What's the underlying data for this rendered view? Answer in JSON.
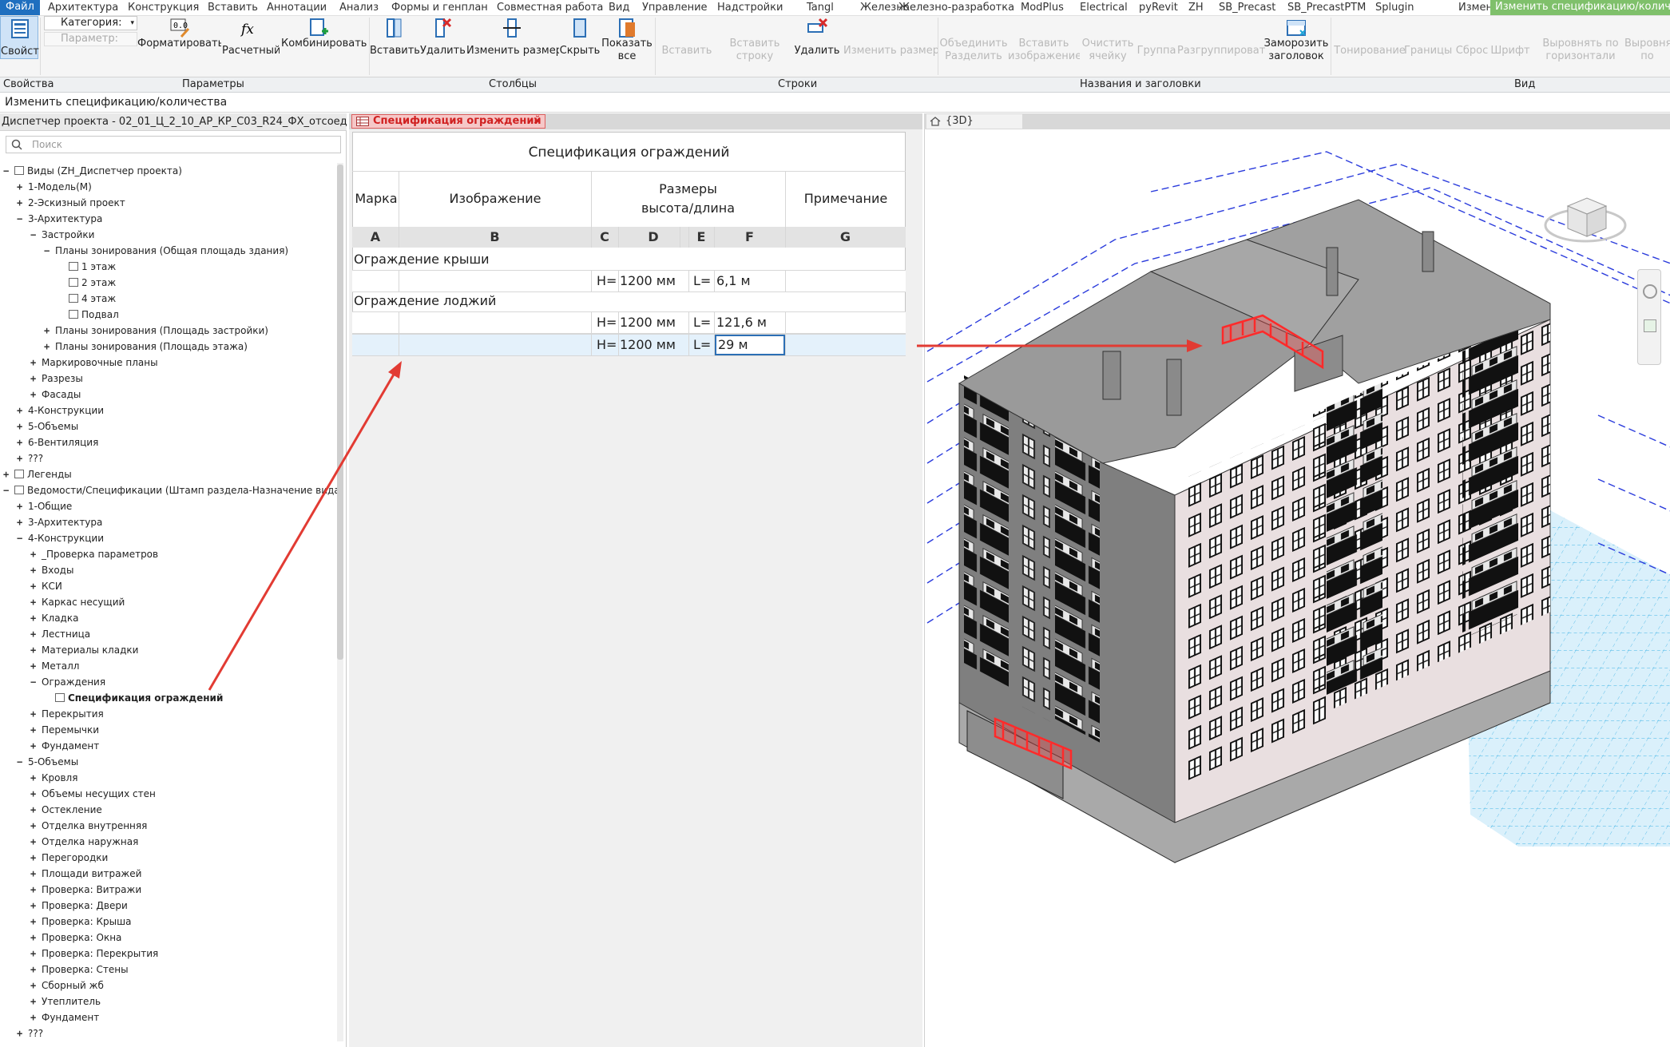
{
  "menu": {
    "items": [
      "Файл",
      "Архитектура",
      "Конструкция",
      "Вставить",
      "Аннотации",
      "Анализ",
      "Формы и генплан",
      "Совместная работа",
      "Вид",
      "Управление",
      "Надстройки",
      "Tangl",
      "Железно",
      "Железно-разработка",
      "ModPlus",
      "Electrical",
      "pyRevit",
      "ZH",
      "SB_Precast",
      "SB_PrecastPTM",
      "Splugin",
      "Изменить",
      "Изменить спецификацию/количес"
    ]
  },
  "ribbon": {
    "properties_btn": "Свойства",
    "category_label": "Категория:",
    "parameter_label": "Параметр:",
    "format_units": "Форматировать единицу",
    "calculated": "Расчетный",
    "combine_params": "Комбинировать параметры",
    "insert": "Вставить",
    "delete": "Удалить",
    "resize": "Изменить размер",
    "hide": "Скрыть",
    "show_all": "Показать все",
    "rows_insert": "Вставить",
    "insert_data_row": "Вставить строку данных",
    "rows_delete": "Удалить",
    "rows_resize": "Изменить размер",
    "merge_unmerge": "Объединить Разделить",
    "insert_image": "Вставить изображение",
    "clear_cell": "Очистить ячейку",
    "group": "Группа",
    "ungroup": "Разгруппировать",
    "freeze_header": "Заморозить заголовок",
    "shading": "Тонирование",
    "borders": "Границы",
    "reset": "Сброс",
    "font": "Шрифт",
    "align_h": "Выровнять по горизонтали",
    "align_v": "Выровнять по верти...",
    "groups": {
      "properties": "Свойства",
      "parameters": "Параметры",
      "columns": "Столбцы",
      "rows": "Строки",
      "titles": "Названия и заголовки",
      "view": "Вид"
    }
  },
  "context_label": "Изменить спецификацию/количества",
  "browser": {
    "title": "Диспетчер проекта - 02_01_Ц_2_10_АР_КР_С03_R24_ФХ_отсоед...",
    "search_placeholder": "Поиск",
    "items": [
      {
        "t": "Виды (ZH_Диспетчер проекта)",
        "l": 0,
        "g": "−",
        "ic": true
      },
      {
        "t": "1-Модель(М)",
        "l": 1,
        "g": "+"
      },
      {
        "t": "2-Эскизный проект",
        "l": 1,
        "g": "+"
      },
      {
        "t": "3-Архитектура",
        "l": 1,
        "g": "−"
      },
      {
        "t": "Застройки",
        "l": 2,
        "g": "−"
      },
      {
        "t": "Планы зонирования (Общая площадь здания)",
        "l": 3,
        "g": "−"
      },
      {
        "t": "1 этаж",
        "l": 4,
        "g": "",
        "ic": true
      },
      {
        "t": "2 этаж",
        "l": 4,
        "g": "",
        "ic": true
      },
      {
        "t": "4 этаж",
        "l": 4,
        "g": "",
        "ic": true
      },
      {
        "t": "Подвал",
        "l": 4,
        "g": "",
        "ic": true
      },
      {
        "t": "Планы зонирования (Площадь застройки)",
        "l": 3,
        "g": "+"
      },
      {
        "t": "Планы зонирования (Площадь этажа)",
        "l": 3,
        "g": "+"
      },
      {
        "t": "Маркировочные планы",
        "l": 2,
        "g": "+"
      },
      {
        "t": "Разрезы",
        "l": 2,
        "g": "+"
      },
      {
        "t": "Фасады",
        "l": 2,
        "g": "+"
      },
      {
        "t": "4-Конструкции",
        "l": 1,
        "g": "+"
      },
      {
        "t": "5-Объемы",
        "l": 1,
        "g": "+"
      },
      {
        "t": "6-Вентиляция",
        "l": 1,
        "g": "+"
      },
      {
        "t": "???",
        "l": 1,
        "g": "+"
      },
      {
        "t": "Легенды",
        "l": 0,
        "g": "+",
        "ic": true
      },
      {
        "t": "Ведомости/Спецификации (Штамп раздела-Назначение вида)",
        "l": 0,
        "g": "−",
        "ic": true
      },
      {
        "t": "1-Общие",
        "l": 1,
        "g": "+"
      },
      {
        "t": "3-Архитектура",
        "l": 1,
        "g": "+"
      },
      {
        "t": "4-Конструкции",
        "l": 1,
        "g": "−"
      },
      {
        "t": "_Проверка параметров",
        "l": 2,
        "g": "+"
      },
      {
        "t": "Входы",
        "l": 2,
        "g": "+"
      },
      {
        "t": "КСИ",
        "l": 2,
        "g": "+"
      },
      {
        "t": "Каркас несущий",
        "l": 2,
        "g": "+"
      },
      {
        "t": "Кладка",
        "l": 2,
        "g": "+"
      },
      {
        "t": "Лестница",
        "l": 2,
        "g": "+"
      },
      {
        "t": "Материалы кладки",
        "l": 2,
        "g": "+"
      },
      {
        "t": "Металл",
        "l": 2,
        "g": "+"
      },
      {
        "t": "Ограждения",
        "l": 2,
        "g": "−"
      },
      {
        "t": "Спецификация ограждений",
        "l": 3,
        "g": "",
        "ic": true,
        "b": true
      },
      {
        "t": "Перекрытия",
        "l": 2,
        "g": "+"
      },
      {
        "t": "Перемычки",
        "l": 2,
        "g": "+"
      },
      {
        "t": "Фундамент",
        "l": 2,
        "g": "+"
      },
      {
        "t": "5-Объемы",
        "l": 1,
        "g": "−"
      },
      {
        "t": "Кровля",
        "l": 2,
        "g": "+"
      },
      {
        "t": "Объемы несущих стен",
        "l": 2,
        "g": "+"
      },
      {
        "t": "Остекление",
        "l": 2,
        "g": "+"
      },
      {
        "t": "Отделка внутренняя",
        "l": 2,
        "g": "+"
      },
      {
        "t": "Отделка наружная",
        "l": 2,
        "g": "+"
      },
      {
        "t": "Перегородки",
        "l": 2,
        "g": "+"
      },
      {
        "t": "Площади витражей",
        "l": 2,
        "g": "+"
      },
      {
        "t": "Проверка: Витражи",
        "l": 2,
        "g": "+"
      },
      {
        "t": "Проверка: Двери",
        "l": 2,
        "g": "+"
      },
      {
        "t": "Проверка: Крыша",
        "l": 2,
        "g": "+"
      },
      {
        "t": "Проверка: Окна",
        "l": 2,
        "g": "+"
      },
      {
        "t": "Проверка: Перекрытия",
        "l": 2,
        "g": "+"
      },
      {
        "t": "Проверка: Стены",
        "l": 2,
        "g": "+"
      },
      {
        "t": "Сборный жб",
        "l": 2,
        "g": "+"
      },
      {
        "t": "Утеплитель",
        "l": 2,
        "g": "+"
      },
      {
        "t": "Фундамент",
        "l": 2,
        "g": "+"
      },
      {
        "t": "???",
        "l": 1,
        "g": "+"
      }
    ]
  },
  "tabs": {
    "schedule": "Спецификация ограждений",
    "view3d": "{3D}"
  },
  "schedule": {
    "title": "Спецификация ограждений",
    "headers": {
      "mark": "Марка",
      "image": "Изображение",
      "dims_line1": "Размеры",
      "dims_line2": "высота/длина",
      "note": "Примечание"
    },
    "letters": [
      "A",
      "B",
      "C",
      "D",
      "E",
      "F",
      "G"
    ],
    "groups": [
      {
        "name": "Ограждение крыши",
        "rows": [
          {
            "h_prefix": "H=",
            "h": "1200 мм",
            "l_prefix": "L=",
            "l": "6,1 м"
          }
        ]
      },
      {
        "name": "Ограждение лоджий",
        "rows": [
          {
            "h_prefix": "H=",
            "h": "1200 мм",
            "l_prefix": "L=",
            "l": "121,6 м"
          },
          {
            "h_prefix": "H=",
            "h": "1200 мм",
            "l_prefix": "L=",
            "l": "29 м"
          }
        ]
      }
    ]
  },
  "colors": {
    "accent": "#1f6fbf",
    "context_tab": "#7fc06b",
    "annotation_red": "#e23b33",
    "railing_red": "#ff2a2a",
    "grid_blue": "#2a3bdc",
    "ground_cyan": "#3fb3e6"
  }
}
